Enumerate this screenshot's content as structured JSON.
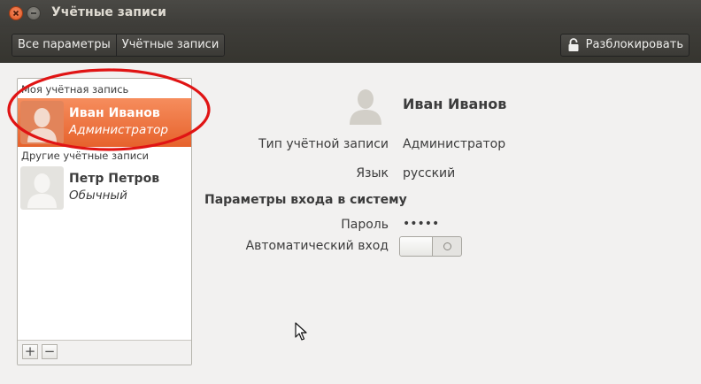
{
  "window": {
    "title": "Учётные записи"
  },
  "toolbar": {
    "breadcrumbs": [
      "Все параметры",
      "Учётные записи"
    ],
    "unlock_label": "Разблокировать"
  },
  "accounts": {
    "my_section_label": "Моя учётная запись",
    "other_section_label": "Другие учётные записи",
    "my_account": {
      "name": "Иван Иванов",
      "role": "Администратор"
    },
    "others": [
      {
        "name": "Петр Петров",
        "role": "Обычный"
      }
    ],
    "add_label": "+",
    "remove_label": "−"
  },
  "details": {
    "name": "Иван Иванов",
    "account_type_label": "Тип учётной записи",
    "account_type_value": "Администратор",
    "language_label": "Язык",
    "language_value": "русский",
    "login_heading": "Параметры входа в систему",
    "password_label": "Пароль",
    "password_value": "•••••",
    "autologin_label": "Автоматический вход",
    "autologin_on": false
  },
  "colors": {
    "selection": "#f07746",
    "annotation": "#e01414"
  }
}
